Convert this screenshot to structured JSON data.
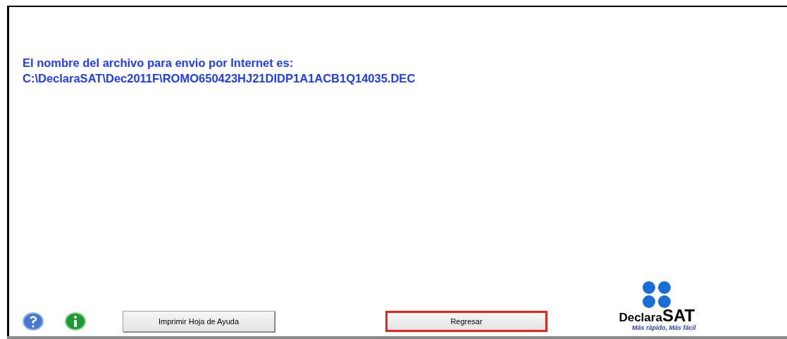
{
  "message": {
    "lines": [
      "El nombre del archivo para envio por Internet es:",
      "C:\\DeclaraSAT\\Dec2011F\\ROMO650423HJ21DIDP1A1ACB1Q14035.DEC"
    ]
  },
  "toolbar": {
    "icons": [
      {
        "kind": "help"
      },
      {
        "kind": "info"
      }
    ],
    "buttons": [
      {
        "label": "Imprimir Hoja de Ayuda",
        "highlighted": false
      },
      {
        "label": "Regresar",
        "highlighted": true
      }
    ]
  },
  "logo": {
    "name": "Declara",
    "name_bold": "SAT",
    "slogan": "Más rápido, Más fácil"
  }
}
